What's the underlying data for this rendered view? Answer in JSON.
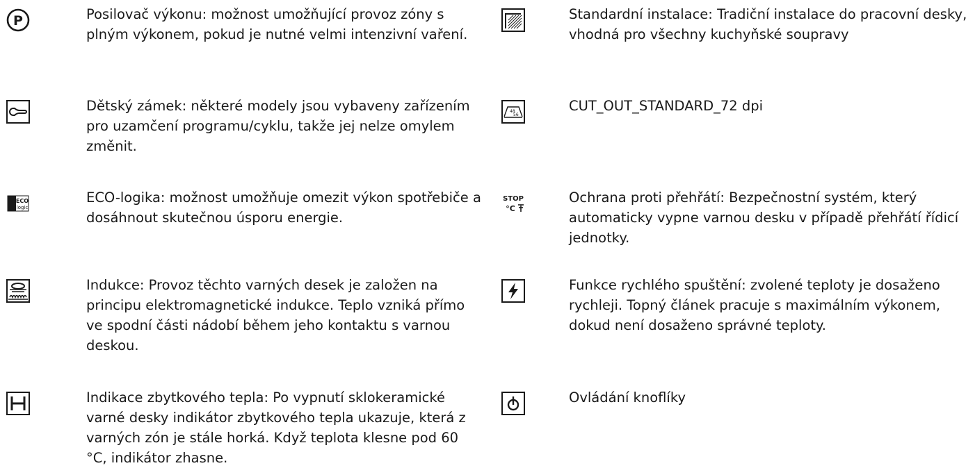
{
  "left_items": [
    {
      "icon": "power-booster-icon",
      "text": "Posilovač výkonu: možnost umožňující provoz zóny s plným výkonem, pokud je nutné velmi intenzivní vaření."
    },
    {
      "icon": "child-lock-icon",
      "text": "Dětský zámek: některé modely jsou vybaveny zařízením pro uzamčení programu/cyklu, takže jej nelze omylem změnit."
    },
    {
      "icon": "eco-logic-icon",
      "text": "ECO-logika: možnost umožňuje omezit výkon spotřebiče a dosáhnout skutečnou úsporu energie."
    },
    {
      "icon": "induction-icon",
      "text": "Indukce: Provoz těchto varných desek je založen na principu elektromagnetické indukce. Teplo vzniká přímo ve spodní části nádobí během jeho kontaktu s varnou deskou."
    },
    {
      "icon": "residual-heat-icon",
      "text": "Indikace zbytkového tepla: Po vypnutí sklokeramické varné desky indikátor zbytkového tepla ukazuje, která z varných zón je stále horká. Když teplota klesne pod 60 °C, indikátor zhasne."
    }
  ],
  "right_items": [
    {
      "icon": "standard-installation-icon",
      "text": "Standardní instalace: Tradiční instalace do pracovní desky, vhodná pro všechny kuchyňské soupravy"
    },
    {
      "icon": "cut-out-icon",
      "text": "CUT_OUT_STANDARD_72 dpi"
    },
    {
      "icon": "overheat-protection-icon",
      "text": "Ochrana proti přehřátí: Bezpečnostní systém, který automaticky vypne varnou desku v případě přehřátí řídicí jednotky."
    },
    {
      "icon": "quick-start-icon",
      "text": "Funkce rychlého spuštění: zvolené teploty je dosaženo rychleji. Topný článek pracuje s maximálním výkonem, dokud není dosaženo správné teploty."
    },
    {
      "icon": "knob-control-icon",
      "text": "Ovládání knoflíky"
    }
  ],
  "icon_labels": {
    "booster": "P",
    "eco_top": "ECO",
    "eco_bottom": "logic",
    "cutout_a": "48",
    "cutout_b": "56",
    "stop": "STOP",
    "celsius": "°C"
  }
}
